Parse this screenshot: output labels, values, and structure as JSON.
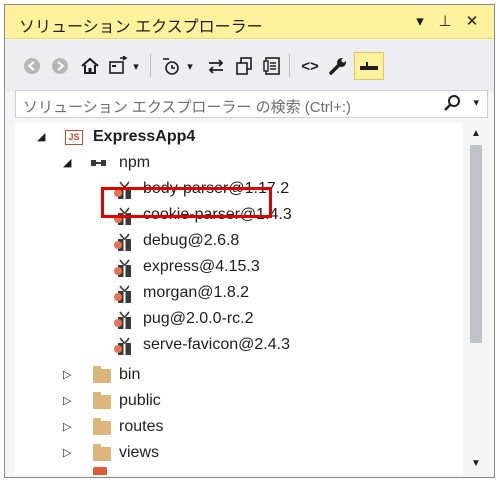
{
  "window": {
    "title": "ソリューション エクスプローラー",
    "buttons": {
      "dropdown": "▾",
      "pin": "⊥",
      "close": "✕"
    }
  },
  "toolbar": {
    "back": "◀",
    "forward": "▶",
    "home": "⌂",
    "sync": "⇆",
    "history_dropdown": "▾",
    "pending": "◷",
    "pending_dropdown": "▾",
    "collapse": "⇆",
    "show_all": "❐",
    "properties": "▤",
    "code": "<>",
    "wrench": "🔧",
    "preview": "▬"
  },
  "search": {
    "placeholder": "ソリューション エクスプローラー の検索 (Ctrl+:)",
    "search_icon": "⚲",
    "dropdown": "▾"
  },
  "tree": {
    "project": {
      "name": "ExpressApp4",
      "icon_text": "JS",
      "expander": "◢"
    },
    "npm": {
      "name": "npm",
      "expander": "◢"
    },
    "packages": [
      "body-parser@1.17.2",
      "cookie-parser@1.4.3",
      "debug@2.6.8",
      "express@4.15.3",
      "morgan@1.8.2",
      "pug@2.0.0-rc.2",
      "serve-favicon@2.4.3"
    ],
    "folders": [
      "bin",
      "public",
      "routes",
      "views"
    ],
    "collapsed_expander": "▷"
  },
  "highlighted_package": "pug@2.0.0-rc.2",
  "scrollbar": {
    "up": "▲",
    "down": "▼"
  },
  "colors": {
    "title_bg": "#fff29d",
    "highlight_border": "#e00000",
    "folder": "#dcb67a",
    "js_icon": "#c94a2b"
  }
}
